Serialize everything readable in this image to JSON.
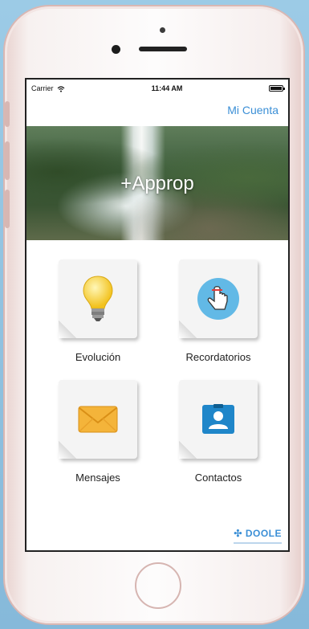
{
  "status_bar": {
    "carrier": "Carrier",
    "time": "11:44 AM"
  },
  "navbar": {
    "account_link": "Mi Cuenta"
  },
  "hero": {
    "title": "+Approp"
  },
  "tiles": [
    {
      "label": "Evolución",
      "icon": "lightbulb-icon"
    },
    {
      "label": "Recordatorios",
      "icon": "reminder-finger-icon"
    },
    {
      "label": "Mensajes",
      "icon": "envelope-icon"
    },
    {
      "label": "Contactos",
      "icon": "contact-card-icon"
    }
  ],
  "brand": {
    "name": "DOOLE"
  },
  "colors": {
    "accent": "#3b8fd6",
    "background": "#9ccbe6"
  }
}
